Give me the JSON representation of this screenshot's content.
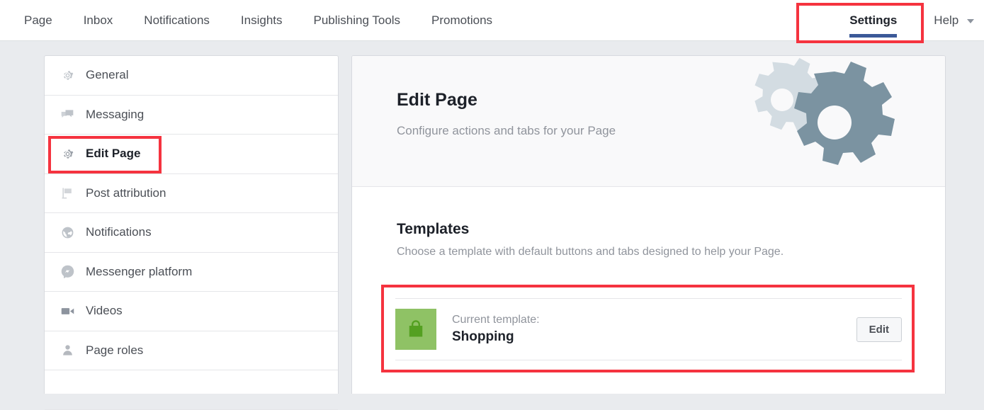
{
  "topnav": {
    "items": [
      {
        "label": "Page",
        "icon": "page-nav"
      },
      {
        "label": "Inbox",
        "icon": "inbox-nav"
      },
      {
        "label": "Notifications",
        "icon": "notifications-nav"
      },
      {
        "label": "Insights",
        "icon": "insights-nav"
      },
      {
        "label": "Publishing Tools",
        "icon": "publishing-tools-nav"
      },
      {
        "label": "Promotions",
        "icon": "promotions-nav"
      }
    ],
    "settings": {
      "label": "Settings",
      "active": true,
      "underline_color": "#3b5998"
    },
    "help": {
      "label": "Help",
      "caret_icon": "chevron-down-icon"
    }
  },
  "sidebar": {
    "items": [
      {
        "label": "General",
        "icon": "gear-icon",
        "active": false
      },
      {
        "label": "Messaging",
        "icon": "chat-bubbles-icon",
        "active": false
      },
      {
        "label": "Edit Page",
        "icon": "gear-icon",
        "active": true
      },
      {
        "label": "Post attribution",
        "icon": "flag-icon",
        "active": false
      },
      {
        "label": "Notifications",
        "icon": "globe-icon",
        "active": false
      },
      {
        "label": "Messenger platform",
        "icon": "messenger-icon",
        "active": false
      },
      {
        "label": "Videos",
        "icon": "video-camera-icon",
        "active": false
      },
      {
        "label": "Page roles",
        "icon": "person-icon",
        "active": false
      }
    ]
  },
  "main": {
    "header": {
      "title": "Edit Page",
      "subtitle": "Configure actions and tabs for your Page",
      "illustration_icon": "two-gears-illustration",
      "gear_light_color": "#d3dce2",
      "gear_dark_color": "#7b93a1"
    },
    "templates": {
      "title": "Templates",
      "subtitle": "Choose a template with default buttons and tabs designed to help your Page.",
      "current": {
        "caption": "Current template:",
        "name": "Shopping",
        "thumb_icon": "shopping-bag-icon",
        "thumb_bg_color": "#8fc265",
        "thumb_icon_color": "#54a021",
        "edit_label": "Edit"
      }
    }
  },
  "annotations": {
    "color": "#f5333f",
    "boxes": [
      {
        "target": "settings-tab"
      },
      {
        "target": "sidebar-item-edit-page"
      },
      {
        "target": "current-template-row"
      }
    ]
  },
  "colors": {
    "page_background": "#e9ebee",
    "panel_background": "#ffffff",
    "panel_header_background": "#f9f9fa",
    "text_primary": "#1d2129",
    "text_secondary": "#4b4f56",
    "text_muted": "#90949c",
    "brand_blue": "#3b5998"
  }
}
